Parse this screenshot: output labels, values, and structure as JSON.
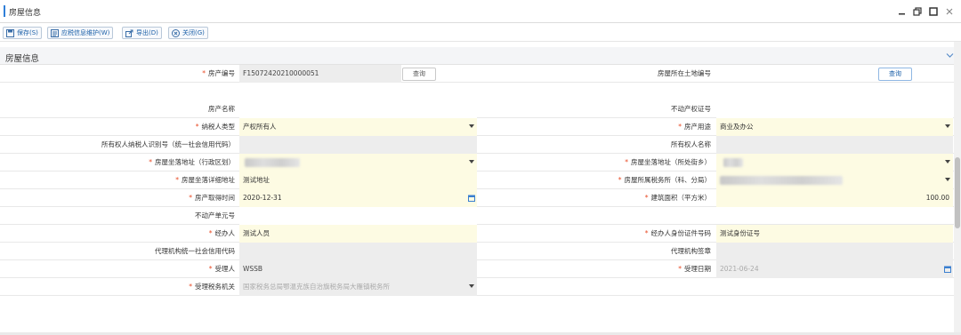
{
  "window": {
    "title": "房屋信息"
  },
  "toolbar": {
    "save_label": "保存(S)",
    "tax_maintain_label": "应税信息维护(W)",
    "export_label": "导出(D)",
    "close_label": "关闭(G)"
  },
  "section": {
    "title": "房屋信息"
  },
  "form": {
    "query_label": "查询",
    "rows": [
      {
        "l1": "房产编号",
        "r1": true,
        "v1": "F15072420210000051",
        "l2": "房屋所在土地编号",
        "r2": false,
        "v2": ""
      },
      {
        "l1": "房产名称",
        "r1": false,
        "v1": "",
        "l2": "不动产权证号",
        "r2": false,
        "v2": ""
      },
      {
        "l1": "纳税人类型",
        "r1": true,
        "v1": "产权所有人",
        "l2": "房产用途",
        "r2": true,
        "v2": "商业及办公"
      },
      {
        "l1": "所有权人纳税人识别号（统一社会信用代码）",
        "r1": false,
        "v1": "",
        "l2": "所有权人名称",
        "r2": false,
        "v2": ""
      },
      {
        "l1": "房屋坐落地址（行政区划）",
        "r1": true,
        "v1": "",
        "l2": "房屋坐落地址（所处街乡）",
        "r2": true,
        "v2": ""
      },
      {
        "l1": "房屋坐落详细地址",
        "r1": true,
        "v1": "测试地址",
        "l2": "房屋所属税务所（科、分局）",
        "r2": true,
        "v2": ""
      },
      {
        "l1": "房产取得时间",
        "r1": true,
        "v1": "2020-12-31",
        "l2": "建筑面积（平方米）",
        "r2": true,
        "v2": "100.00"
      },
      {
        "l1": "不动产单元号",
        "r1": false,
        "v1": "",
        "l2": "",
        "r2": false,
        "v2": ""
      },
      {
        "l1": "经办人",
        "r1": true,
        "v1": "测试人员",
        "l2": "经办人身份证件号码",
        "r2": true,
        "v2": "测试身份证号"
      },
      {
        "l1": "代理机构统一社会信用代码",
        "r1": false,
        "v1": "",
        "l2": "代理机构签章",
        "r2": false,
        "v2": ""
      },
      {
        "l1": "受理人",
        "r1": true,
        "v1": "WSSB",
        "l2": "受理日期",
        "r2": true,
        "v2": "2021-06-24"
      },
      {
        "l1": "受理税务机关",
        "r1": true,
        "v1": "国家税务总局鄂温克族自治旗税务局大雁镇税务所",
        "l2": "",
        "r2": false,
        "v2": ""
      }
    ]
  },
  "colors": {
    "accent": "#2f7fd8",
    "required": "#e84a25",
    "editable_bg": "#fdfbe3",
    "readonly_bg": "#ededed"
  }
}
